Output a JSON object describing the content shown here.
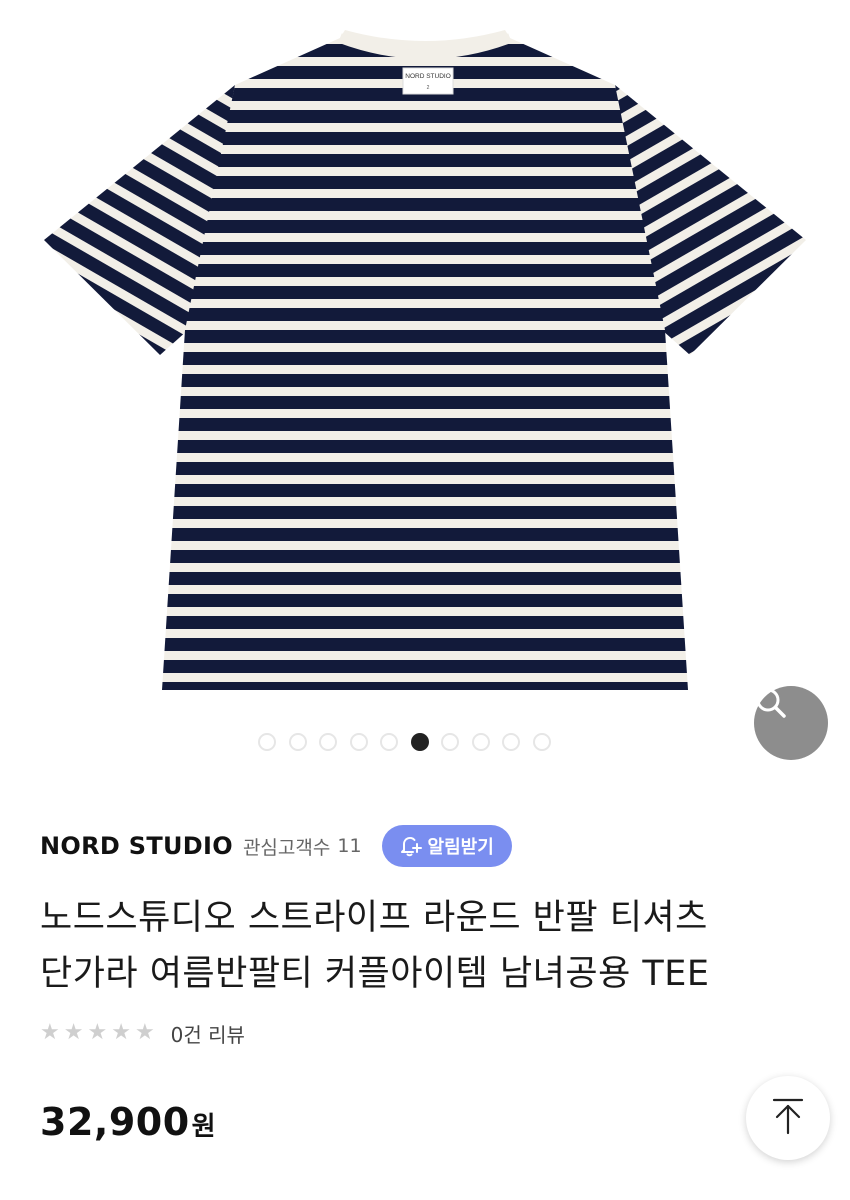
{
  "product_image": {
    "label_brand": "NORD STUDIO",
    "label_size": "2",
    "stripe_color": "#121a3a",
    "base_color": "#f2efe8"
  },
  "gallery": {
    "total_images": 10,
    "active_index": 5
  },
  "brand": {
    "name": "NORD STUDIO",
    "interest_label": "관심고객수",
    "interest_count": "11",
    "notify_label": "알림받기",
    "accent_color": "#7a8ef0"
  },
  "product": {
    "title_line1": "노드스튜디오 스트라이프 라운드 반팔 티셔츠",
    "title_line2": "단가라 여름반팔티 커플아이템 남녀공용 TEE",
    "rating_stars": 0,
    "rating_max": 5,
    "review_text": "0건 리뷰",
    "price": "32,900",
    "currency": "원"
  },
  "icons": {
    "zoom": "search-icon",
    "notify": "bell-plus-icon",
    "top": "arrow-up-to-top-icon",
    "star": "star-icon"
  }
}
